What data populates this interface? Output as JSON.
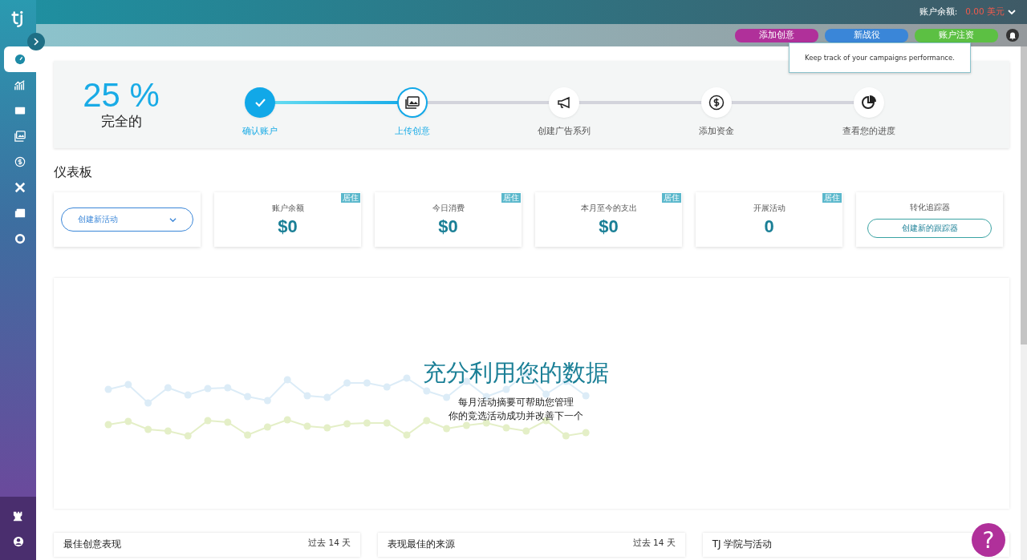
{
  "header": {
    "balance_label": "账户余额:",
    "balance_value": "0.00 美元"
  },
  "actions": [
    {
      "label": "添加创意",
      "color": "#b0309a"
    },
    {
      "label": "新战役",
      "color": "#3a86d8"
    },
    {
      "label": "账户注资",
      "color": "#5cc043"
    }
  ],
  "tooltip": {
    "text": "Keep track of your campaigns performance."
  },
  "sidebar": {
    "items": [
      {
        "selected": true
      },
      {
        "selected": false
      },
      {
        "selected": false
      },
      {
        "selected": false
      },
      {
        "selected": false
      },
      {
        "selected": false
      },
      {
        "selected": false
      },
      {
        "selected": false
      }
    ]
  },
  "progress": {
    "percent": "25 %",
    "caption": "完全的",
    "steps": [
      {
        "label": "确认账户",
        "completed": true,
        "selected": false
      },
      {
        "label": "上传创意",
        "completed": false,
        "selected": true
      },
      {
        "label": "创建广告系列",
        "completed": false,
        "selected": false
      },
      {
        "label": "添加资金",
        "completed": false,
        "selected": false
      },
      {
        "label": "查看您的进度",
        "completed": false,
        "selected": false
      }
    ]
  },
  "dashboard": {
    "title": "仪表板",
    "campaign_select": {
      "value": "创建新活动"
    },
    "stats": [
      {
        "label": "账户余额",
        "value": "$0",
        "badge": "居住"
      },
      {
        "label": "今日消费",
        "value": "$0",
        "badge": "居住"
      },
      {
        "label": "本月至今的支出",
        "value": "$0",
        "badge": "居住"
      },
      {
        "label": "开展活动",
        "value": "0",
        "badge": "居住"
      }
    ],
    "tracker": {
      "label": "转化追踪器",
      "button": "创建新的跟踪器"
    }
  },
  "promo": {
    "title": "充分利用您的数据",
    "lines": [
      "每月活动摘要可帮助您管理",
      "你的竞选活动成功并改善下一个"
    ]
  },
  "bottom_cards": [
    {
      "title": "最佳创意表现",
      "period": "过去 14 天"
    },
    {
      "title": "表现最佳的来源",
      "period": "过去 14 天"
    },
    {
      "title": "TJ 学院与活动"
    }
  ],
  "help": {
    "label": "?"
  }
}
